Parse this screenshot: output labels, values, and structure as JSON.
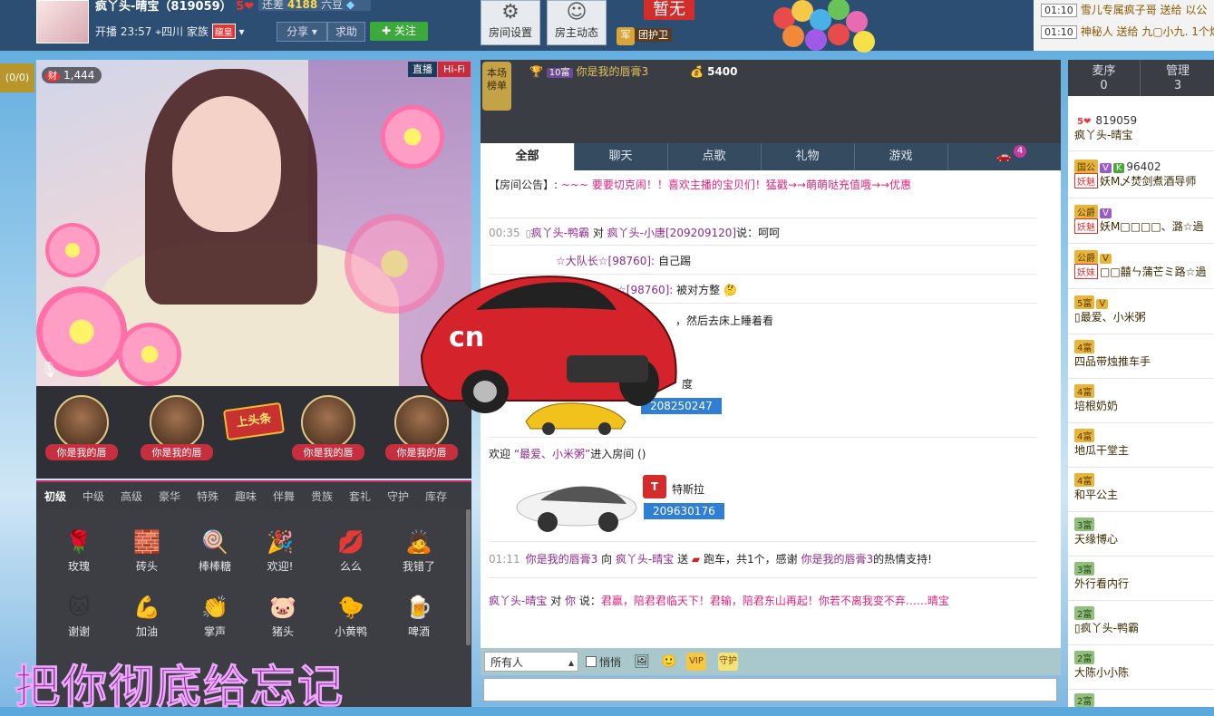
{
  "header": {
    "host_name": "疯丫头-晴宝（819059）",
    "host_level": "5",
    "gap_label": "还差",
    "gap_value": "4188",
    "gap_unit": "六豆",
    "live_time": "开播 23:57",
    "location": "四川",
    "family_label": "家族",
    "family_badge": "龍皇",
    "share_label": "分享",
    "help_label": "求助",
    "follow_label": "关注",
    "room_settings_label": "房间设置",
    "host_feed_label": "房主动态",
    "slot_status": "暂无",
    "guard_label": "团护卫",
    "guard_badge": "军"
  },
  "gift_feed": [
    {
      "time": "01:10",
      "text": "雪儿专属疯子哥 送给 以公"
    },
    {
      "time": "01:10",
      "text": "神秘人 送给 九▢小九. 1个烟"
    }
  ],
  "left_tab": "(0/0)",
  "video": {
    "fortune_icon": "财",
    "fortune_value": "1,444",
    "live_badge": "直播",
    "hifi_badge": "Hi-Fi"
  },
  "seats": [
    {
      "name": "你是我的唇"
    },
    {
      "name": "你是我的唇"
    },
    {
      "name": "你是我的唇"
    },
    {
      "name": "你是我的唇"
    }
  ],
  "headline_label": "上头条",
  "gift_tabs": [
    "初级",
    "中级",
    "高级",
    "豪华",
    "特殊",
    "趣味",
    "伴舞",
    "贵族",
    "套礼",
    "守护",
    "库存"
  ],
  "gifts_row1": [
    {
      "icon": "🌹",
      "name": "玫瑰"
    },
    {
      "icon": "🧱",
      "name": "砖头"
    },
    {
      "icon": "🍭",
      "name": "棒棒糖"
    },
    {
      "icon": "🎉",
      "name": "欢迎!"
    },
    {
      "icon": "💋",
      "name": "么么"
    },
    {
      "icon": "🙇",
      "name": "我错了"
    }
  ],
  "gifts_row2": [
    {
      "icon": "🐱",
      "name": "谢谢"
    },
    {
      "icon": "💪",
      "name": "加油"
    },
    {
      "icon": "👏",
      "name": "掌声"
    },
    {
      "icon": "🐷",
      "name": "猪头"
    },
    {
      "icon": "🐤",
      "name": "小黄鸭"
    },
    {
      "icon": "🍺",
      "name": "啤酒"
    }
  ],
  "lyrics": "把你彻底给忘记",
  "rank": {
    "label": "本场榜单",
    "user_level": "10富",
    "user_name": "你是我的唇膏3",
    "score": "5400"
  },
  "chat_tabs": [
    "全部",
    "聊天",
    "点歌",
    "礼物",
    "游戏"
  ],
  "car_count": "4",
  "chat": {
    "announce_label": "【房间公告】:",
    "announce_text": "~~~ 要要切克闹！！喜欢主播的宝贝们！猛戳→→萌萌哒充值哦→→优惠",
    "msg1_time": "00:35",
    "msg1_user": "疯丫头-鸭霸",
    "msg1_to_word": "对",
    "msg1_target": "疯丫头-小唐[209209120]",
    "msg1_say_word": "说：",
    "msg1_text": "呵呵",
    "msg2_target": "☆大队长☆[98760]:",
    "msg2_text": "自己踢",
    "msg3_target": "☆[98760]:",
    "msg3_text": "被对方整",
    "msg4_text": "，然后去床上睡着看",
    "msg5_text": "度",
    "car_id_1": "208250247",
    "welcome_prefix": "欢迎",
    "welcome_user": "“最爱、小米粥”",
    "welcome_suffix": "进入房间",
    "car_name_2": "特斯拉",
    "car_id_2": "209630176",
    "gift_time": "01:11",
    "gift_user": "你是我的唇膏3",
    "gift_to": "向",
    "gift_target": "疯丫头-晴宝",
    "gift_send": "送",
    "gift_item": "跑车，共1个，感谢",
    "gift_thanks_user": "你是我的唇膏3",
    "gift_thanks": "的热情支持!",
    "private_user": "疯丫头-晴宝",
    "private_to": "对",
    "private_you": "你",
    "private_say": "说：",
    "private_text": "君赢，陪君君临天下！君输，陪君东山再起！你若不离我变不弃……晴宝"
  },
  "input": {
    "target": "所有人",
    "whisper": "悄悄"
  },
  "right_tabs": [
    {
      "label": "麦序",
      "count": "0"
    },
    {
      "label": "管理",
      "count": "3"
    }
  ],
  "users": [
    {
      "badge": "5❤",
      "id": "819059",
      "name": "疯丫头-晴宝"
    },
    {
      "badge": "国公",
      "id": "96402",
      "name": "妖M乄焚剑煮酒导师",
      "tag": "妖魅"
    },
    {
      "badge": "公爵",
      "id": "",
      "name": "妖M□□□□、潞☆過",
      "tag": "妖魅"
    },
    {
      "badge": "公爵",
      "id": "",
      "name": "□□囍ㄣ蒲芒ミ路☆過",
      "tag": "妖妹"
    },
    {
      "badge": "5富",
      "id": "",
      "name": "最爱、小米粥"
    },
    {
      "badge": "4富",
      "id": "",
      "name": "四品带烛推车手"
    },
    {
      "badge": "4富",
      "id": "",
      "name": "培根奶奶"
    },
    {
      "badge": "4富",
      "id": "",
      "name": "地瓜干堂主"
    },
    {
      "badge": "4富",
      "id": "",
      "name": "和平公主"
    },
    {
      "badge": "3富",
      "id": "",
      "name": "天缘博心"
    },
    {
      "badge": "3富",
      "id": "",
      "name": "外行看内行"
    },
    {
      "badge": "2富",
      "id": "",
      "name": "疯丫头-鸭霸"
    },
    {
      "badge": "2富",
      "id": "",
      "name": "大陈小小陈"
    },
    {
      "badge": "2富",
      "id": "",
      "name": ""
    }
  ]
}
